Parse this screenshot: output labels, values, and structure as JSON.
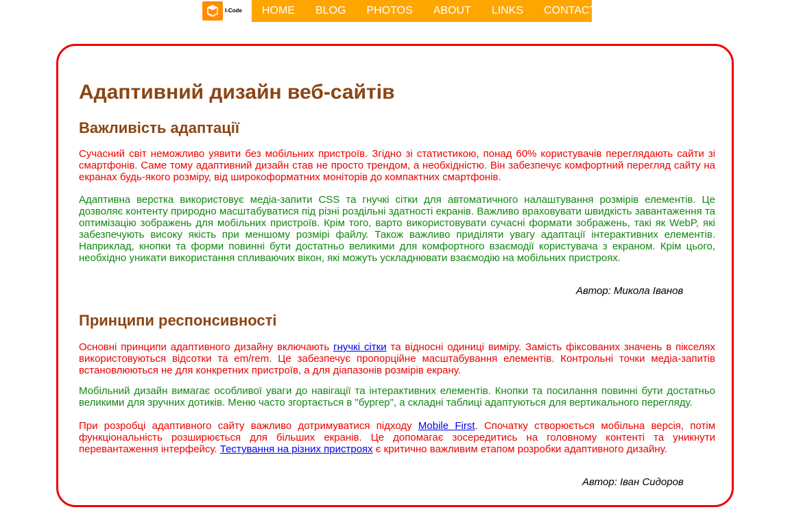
{
  "logo": {
    "text": "I-Code",
    "icon": "cube-logo-icon",
    "color": "#ff8c00"
  },
  "nav": {
    "items": [
      "HOME",
      "BLOG",
      "PHOTOS",
      "ABOUT",
      "LINKS",
      "CONTACT"
    ],
    "background": "#ffa500"
  },
  "article": {
    "title": "Адаптивний дизайн веб-сайтів",
    "section1": {
      "heading": "Важливість адаптації",
      "p1": "Сучасний світ неможливо уявити без мобільних пристроїв. Згідно зі статистикою, понад 60% користувачів переглядають сайти зі смартфонів. Саме тому адаптивний дизайн став не просто трендом, а необхідністю. Він забезпечує комфортний перегляд сайту на екранах будь-якого розміру, від широкоформатних моніторів до компактних смартфонів.",
      "p2": "Адаптивна верстка використовує медіа-запити CSS та гнучкі сітки для автоматичного налаштування розмірів елементів. Це дозволяє контенту природно масштабуватися під різні роздільні здатності екранів. Важливо враховувати швидкість завантаження та оптимізацію зображень для мобільних пристроїв. Крім того, варто використовувати сучасні формати зображень, такі як WebP, які забезпечують високу якість при меншому розмірі файлу. Також важливо приділяти увагу адаптації інтерактивних елементів. Наприклад, кнопки та форми повинні бути достатньо великими для комфортного взаємодії користувача з екраном. Крім цього, необхідно уникати використання спливаючих вікон, які можуть ускладнювати взаємодію на мобільних пристроях.",
      "author": "Автор: Микола Іванов"
    },
    "section2": {
      "heading": "Принципи респонсивності",
      "p1_before": "Основні принципи адаптивного дизайну включають ",
      "p1_link": "гнучкі сітки",
      "p1_after": " та відносні одиниці виміру. Замість фіксованих значень в пікселях використовуються відсотки та em/rem. Це забезпечує пропорційне масштабування елементів. Контрольні точки медіа-запитів встановлюються не для конкретних пристроїв, а для діапазонів розмірів екрану.",
      "p2": "Мобільний дизайн вимагає особливої уваги до навігації та інтерактивних елементів. Кнопки та посилання повинні бути достатньо великими для зручних дотиків. Меню часто згортається в \"бургер\", а складні таблиці адаптуються для вертикального перегляду.",
      "p3_before": "При розробці адаптивного сайту важливо дотримуватися підходу ",
      "p3_link1": "Mobile First",
      "p3_middle": ". Спочатку створюється мобільна версія, потім функціональність розширюється для більших екранів. Це допомагає зосередитись на головному контенті та уникнути перевантаження інтерфейсу. ",
      "p3_link2": "Тестування на різних пристроях",
      "p3_after": " є критично важливим етапом розробки адаптивного дизайну.",
      "author": "Автор: Іван Сидоров"
    }
  },
  "colors": {
    "heading": "#8b4513",
    "red_text": "#ee0000",
    "green_text": "#118811",
    "card_border": "#ee0000",
    "link": "#0000ee"
  }
}
